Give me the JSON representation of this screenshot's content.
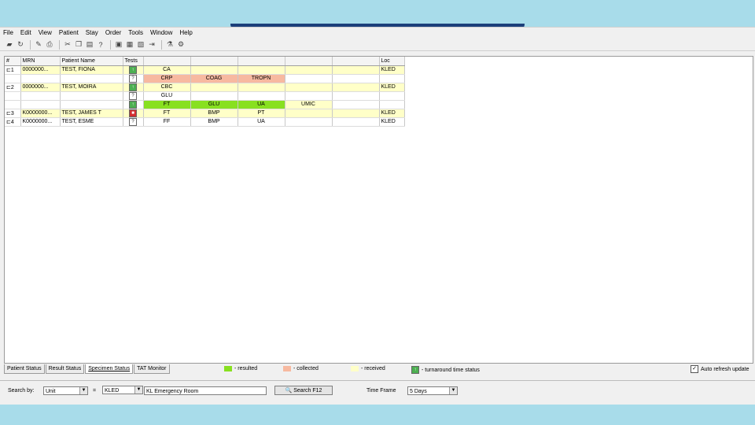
{
  "menu": [
    "File",
    "Edit",
    "View",
    "Patient",
    "Stay",
    "Order",
    "Tools",
    "Window",
    "Help"
  ],
  "columns": {
    "hash": "#",
    "mrn": "MRN",
    "name": "Patient Name",
    "tests": "Tests",
    "loc": "Loc"
  },
  "rows": [
    {
      "num": "1",
      "mrn": "0000000...",
      "name": "TEST, FIONA",
      "status": "green",
      "t1": "CA",
      "t1c": "y",
      "t2": "",
      "t2c": "",
      "t3": "",
      "t3c": "",
      "t4": "",
      "t4c": "",
      "loc": "KLED",
      "yellow": true
    },
    {
      "num": "",
      "mrn": "",
      "name": "",
      "status": "white",
      "t1": "CRP",
      "t1c": "o",
      "t2": "COAG",
      "t2c": "o",
      "t3": "TROPN",
      "t3c": "o",
      "t4": "",
      "t4c": "",
      "loc": "",
      "yellow": false
    },
    {
      "num": "2",
      "mrn": "0000000...",
      "name": "TEST, MOIRA",
      "status": "green",
      "t1": "CBC",
      "t1c": "y",
      "t2": "",
      "t2c": "",
      "t3": "",
      "t3c": "",
      "t4": "",
      "t4c": "",
      "loc": "KLED",
      "yellow": true
    },
    {
      "num": "",
      "mrn": "",
      "name": "",
      "status": "white",
      "t1": "GLU",
      "t1c": "",
      "t2": "",
      "t2c": "",
      "t3": "",
      "t3c": "",
      "t4": "",
      "t4c": "",
      "loc": "",
      "yellow": false
    },
    {
      "num": "",
      "mrn": "",
      "name": "",
      "status": "green",
      "t1": "FT",
      "t1c": "g",
      "t2": "GLU",
      "t2c": "g",
      "t3": "UA",
      "t3c": "g",
      "t4": "UMIC",
      "t4c": "y",
      "loc": "",
      "yellow": false
    },
    {
      "num": "3",
      "mrn": "K0000000...",
      "name": "TEST, JAMES T",
      "status": "red",
      "t1": "FT",
      "t1c": "y",
      "t2": "BMP",
      "t2c": "y",
      "t3": "PT",
      "t3c": "y",
      "t4": "",
      "t4c": "",
      "loc": "KLED",
      "yellow": true
    },
    {
      "num": "4",
      "mrn": "K0000000...",
      "name": "TEST, ESME",
      "status": "white",
      "t1": "FF",
      "t1c": "",
      "t2": "BMP",
      "t2c": "",
      "t3": "UA",
      "t3c": "",
      "t4": "",
      "t4c": "",
      "loc": "KLED",
      "yellow": false
    }
  ],
  "tabs": [
    "Patient Status",
    "Result Status",
    "Specimen Status",
    "TAT Monitor"
  ],
  "legend": {
    "resulted": "- resulted",
    "collected": "- collected",
    "received": "- received",
    "turnaround": "- turnaround time status"
  },
  "colors": {
    "resulted": "#88e020",
    "collected": "#f7b9a0",
    "received": "#ffffc8"
  },
  "auto_refresh": {
    "label": "Auto refresh update",
    "checked": true
  },
  "search": {
    "label": "Search by:",
    "by_value": "Unit",
    "equals": "=",
    "unit_value": "KLED",
    "unit_desc": "KL Emergency Room",
    "button": "Search  F12",
    "timeframe_label": "Time Frame",
    "timeframe_value": "5 Days"
  }
}
